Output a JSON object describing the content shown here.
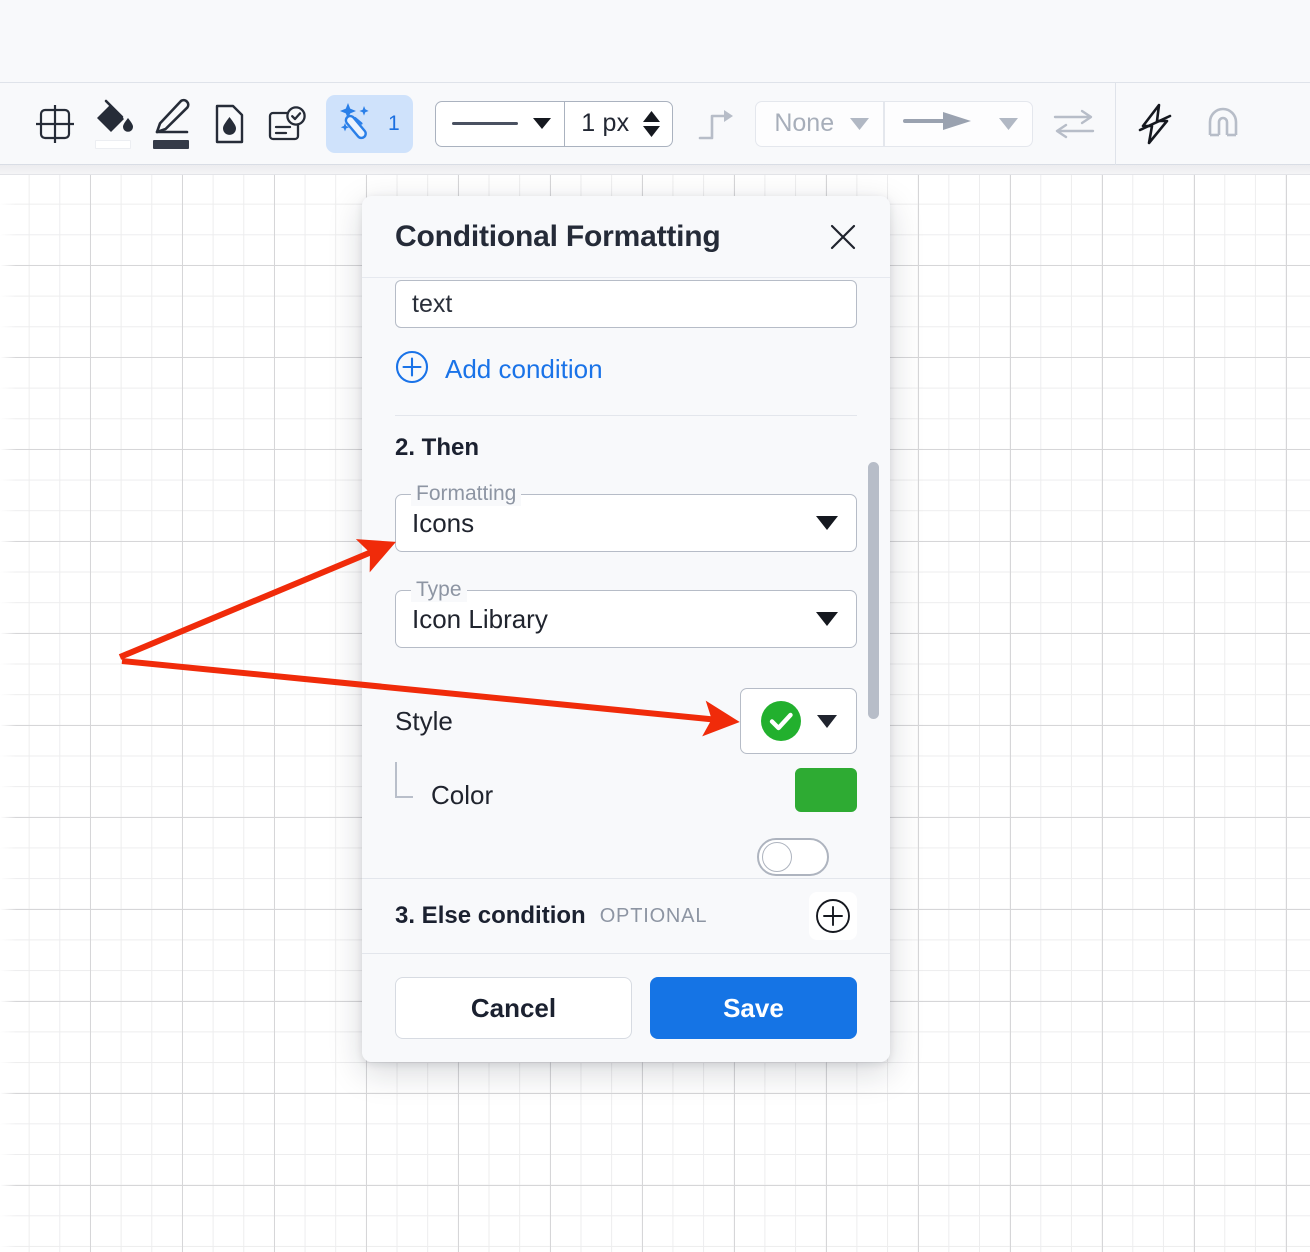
{
  "toolbar": {
    "tools": [
      {
        "name": "crosshair-frame-icon",
        "label": "Select area"
      },
      {
        "name": "fill-bucket-icon",
        "label": "Fill color",
        "swatch": "#ffffff"
      },
      {
        "name": "pen-icon",
        "label": "Line color",
        "swatch": "#353b48"
      },
      {
        "name": "ink-drop-icon",
        "label": "Opacity"
      },
      {
        "name": "text-style-icon",
        "label": "Text style"
      }
    ],
    "magic": {
      "label": "1",
      "name": "magic-wand-icon",
      "accent": "#1b6fe0",
      "background": "#cfe2fb"
    },
    "line_style": {
      "value": "solid",
      "dropdown": "▼"
    },
    "line_width": {
      "value": "1 px"
    },
    "corner_style": {
      "name": "elbow-connector-icon"
    },
    "arrow_start": {
      "value": "None"
    },
    "arrow_end": {
      "value": "arrow-filled"
    },
    "swap": {
      "name": "swap-arrows-icon"
    },
    "lightning": {
      "name": "lightning-bolt-icon"
    },
    "magnet": {
      "name": "magnet-icon"
    }
  },
  "dialog": {
    "title": "Conditional Formatting",
    "close_label": "×",
    "condition_text": "text",
    "add_condition_label": "Add condition",
    "step2_title": "2. Then",
    "formatting": {
      "legend": "Formatting",
      "value": "Icons"
    },
    "type": {
      "legend": "Type",
      "value": "Icon Library"
    },
    "style": {
      "label": "Style",
      "icon": "check-circle",
      "icon_color": "#22b02e"
    },
    "color": {
      "label": "Color",
      "value": "#2eab33"
    },
    "step3": {
      "title": "3. Else condition",
      "optional": "OPTIONAL",
      "add": "+"
    },
    "footer": {
      "cancel": "Cancel",
      "save": "Save",
      "save_color": "#1574e5"
    }
  },
  "annotations": {
    "arrow_color": "#f02b0a",
    "arrows": [
      {
        "name": "arrow-to-formatting-field",
        "from": [
          120,
          657
        ],
        "to": [
          392,
          545
        ]
      },
      {
        "name": "arrow-to-style-picker",
        "from": [
          122,
          661
        ],
        "to": [
          736,
          722
        ]
      }
    ]
  }
}
